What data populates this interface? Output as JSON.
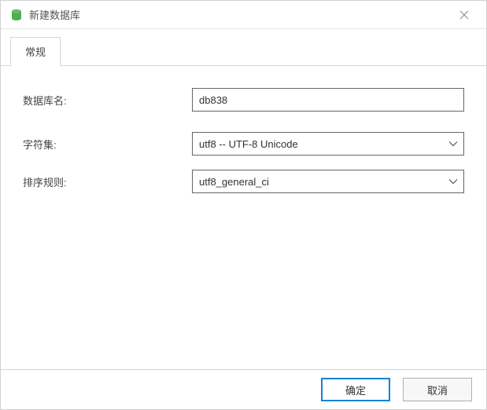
{
  "window": {
    "title": "新建数据库"
  },
  "tabs": {
    "general": "常规"
  },
  "form": {
    "db_name_label": "数据库名:",
    "db_name_value": "db838",
    "charset_label": "字符集:",
    "charset_value": "utf8 -- UTF-8 Unicode",
    "collation_label": "排序规则:",
    "collation_value": "utf8_general_ci"
  },
  "footer": {
    "ok": "确定",
    "cancel": "取消"
  }
}
